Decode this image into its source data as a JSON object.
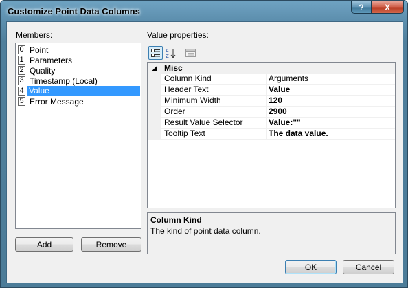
{
  "window": {
    "title": "Customize Point Data Columns",
    "help_glyph": "?",
    "close_glyph": "X"
  },
  "members": {
    "label": "Members:",
    "items": [
      {
        "index": "0",
        "name": "Point"
      },
      {
        "index": "1",
        "name": "Parameters"
      },
      {
        "index": "2",
        "name": "Quality"
      },
      {
        "index": "3",
        "name": "Timestamp (Local)"
      },
      {
        "index": "4",
        "name": "Value",
        "selected": true
      },
      {
        "index": "5",
        "name": "Error Message"
      }
    ],
    "add_label": "Add",
    "remove_label": "Remove"
  },
  "properties": {
    "label": "Value properties:",
    "toolbar": {
      "categorized_icon": "categorized-icon",
      "alphabetical_icon": "alphabetical-icon",
      "property_pages_icon": "property-pages-icon"
    },
    "category": {
      "name": "Misc",
      "toggle": "◢"
    },
    "rows": [
      {
        "name": "Column Kind",
        "value": "Arguments",
        "bold": false
      },
      {
        "name": "Header Text",
        "value": "Value",
        "bold": true
      },
      {
        "name": "Minimum Width",
        "value": "120",
        "bold": true
      },
      {
        "name": "Order",
        "value": "2900",
        "bold": true
      },
      {
        "name": "Result Value Selector",
        "value": "Value:\"\"",
        "bold": true
      },
      {
        "name": "Tooltip Text",
        "value": "The data value.",
        "bold": true
      }
    ],
    "description": {
      "title": "Column Kind",
      "text": "The kind of point data column."
    }
  },
  "dialog_buttons": {
    "ok_label": "OK",
    "cancel_label": "Cancel"
  },
  "colors": {
    "selection": "#3399ff",
    "frame": "#5d8fae",
    "close": "#c7462f"
  }
}
